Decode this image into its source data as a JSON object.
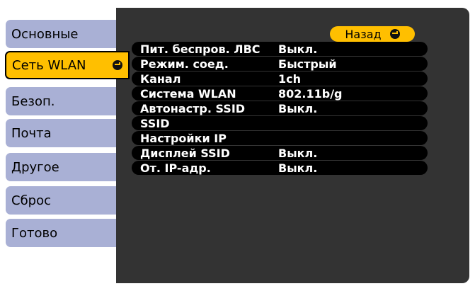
{
  "sidebar": {
    "items": [
      {
        "label": "Основные"
      },
      {
        "label": "Сеть WLAN"
      },
      {
        "label": "Безоп."
      },
      {
        "label": "Почта"
      },
      {
        "label": "Другое"
      },
      {
        "label": "Сброс"
      },
      {
        "label": "Готово"
      }
    ],
    "active_index": 1
  },
  "main": {
    "back_label": "Назад",
    "rows": [
      {
        "label": "Пит. беспров. ЛВС",
        "value": "Выкл."
      },
      {
        "label": "Режим. соед.",
        "value": "Быстрый"
      },
      {
        "label": "Канал",
        "value": "1ch"
      },
      {
        "label": "Система WLAN",
        "value": "802.11b/g"
      },
      {
        "label": "Автонастр. SSID",
        "value": "Выкл."
      },
      {
        "label": "SSID",
        "value": ""
      },
      {
        "label": "Настройки IP",
        "value": ""
      },
      {
        "label": "Дисплей SSID",
        "value": "Выкл."
      },
      {
        "label": "От. IP-адр.",
        "value": "Выкл."
      }
    ]
  },
  "colors": {
    "accent": "#ffbf00",
    "tab_inactive": "#a9b0d5",
    "panel": "#333333",
    "row_bg": "#000000"
  },
  "icons": {
    "enter": "enter-icon"
  }
}
